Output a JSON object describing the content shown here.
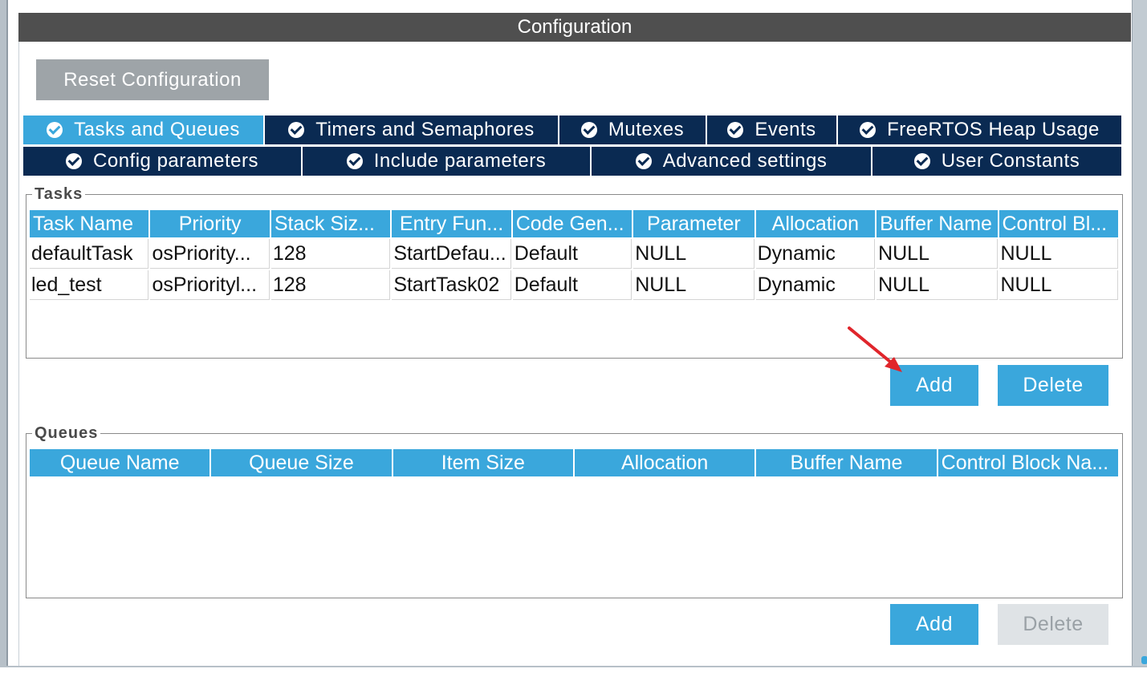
{
  "title": "Configuration",
  "reset_button": "Reset Configuration",
  "tabs_row1": [
    {
      "label": "Tasks and Queues",
      "active": true
    },
    {
      "label": "Timers and Semaphores",
      "active": false
    },
    {
      "label": "Mutexes",
      "active": false
    },
    {
      "label": "Events",
      "active": false
    },
    {
      "label": "FreeRTOS Heap Usage",
      "active": false
    }
  ],
  "tabs_row2": [
    {
      "label": "Config parameters"
    },
    {
      "label": "Include parameters"
    },
    {
      "label": "Advanced settings"
    },
    {
      "label": "User Constants"
    }
  ],
  "tasks": {
    "label": "Tasks",
    "columns": [
      "Task Name",
      "Priority",
      "Stack Siz...",
      "Entry Fun...",
      "Code Gen...",
      "Parameter",
      "Allocation",
      "Buffer Name",
      "Control Bl..."
    ],
    "rows": [
      [
        "defaultTask",
        "osPriority...",
        "128",
        "StartDefau...",
        "Default",
        "NULL",
        "Dynamic",
        "NULL",
        "NULL"
      ],
      [
        "led_test",
        "osPriorityl...",
        "128",
        "StartTask02",
        "Default",
        "NULL",
        "Dynamic",
        "NULL",
        "NULL"
      ]
    ],
    "add_label": "Add",
    "delete_label": "Delete"
  },
  "queues": {
    "label": "Queues",
    "columns": [
      "Queue Name",
      "Queue Size",
      "Item Size",
      "Allocation",
      "Buffer Name",
      "Control Block Na..."
    ],
    "rows": [],
    "add_label": "Add",
    "delete_label": "Delete"
  },
  "colors": {
    "accent": "#3aa7dc",
    "tab_bg": "#0a2a52",
    "title_bg": "#4f4f4f",
    "reset_bg": "#9ea4a8",
    "annotation_arrow": "#e0252b"
  }
}
